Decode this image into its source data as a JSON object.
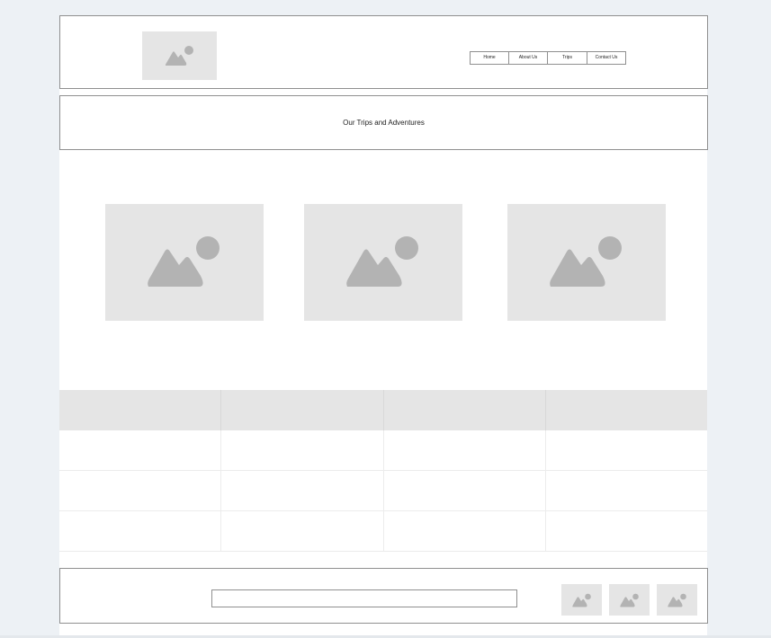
{
  "nav": {
    "items": [
      {
        "label": "Home"
      },
      {
        "label": "About Us"
      },
      {
        "label": "Trips"
      },
      {
        "label": "Contact Us"
      }
    ]
  },
  "banner": {
    "title": "Our Trips and Adventures"
  },
  "table": {
    "columns": 4,
    "rows": 3
  },
  "footer": {
    "input_value": ""
  },
  "colors": {
    "background": "#edf1f5",
    "placeholder_fill": "#e5e5e5",
    "placeholder_icon": "#b3b3b3",
    "border": "#8f8f8f"
  },
  "icons": {
    "image_placeholder": "image-placeholder-icon"
  }
}
